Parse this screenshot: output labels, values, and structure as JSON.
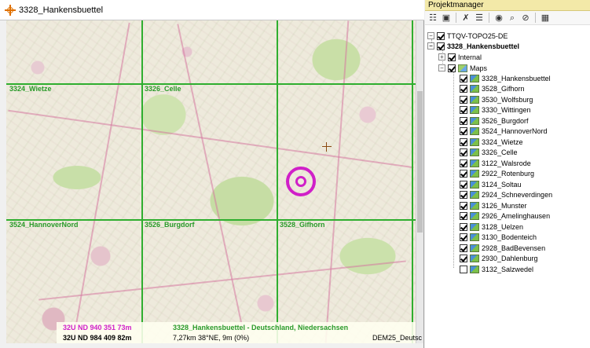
{
  "map_window": {
    "title": "3328_Hankensbuettel",
    "sheet_labels": [
      {
        "text": "3324_Wietze"
      },
      {
        "text": "3326_Celle"
      },
      {
        "text": "3524_HannoverNord"
      },
      {
        "text": "3526_Burgdorf"
      },
      {
        "text": "3528_Gifhorn"
      }
    ],
    "status": {
      "coord_utm_primary": "32U ND 940 351  73m",
      "coord_utm_secondary": "32U ND 984 409  82m",
      "sheet_info": "3328_Hankensbuettel - Deutschland, Niedersachsen",
      "distance_info": "7,27km 38°NE,  9m (0%)",
      "dem_info": "DEM25_Deutsc"
    }
  },
  "project_manager": {
    "title": "Projektmanager",
    "toolbar": [
      {
        "name": "tree-view-icon",
        "glyph": "☷"
      },
      {
        "name": "save-icon",
        "glyph": "▣"
      },
      {
        "name": "delete-icon",
        "glyph": "✗"
      },
      {
        "name": "properties-icon",
        "glyph": "☰"
      },
      {
        "name": "center-icon",
        "glyph": "◉"
      },
      {
        "name": "search-icon",
        "glyph": "⌕"
      },
      {
        "name": "hide-icon",
        "glyph": "⊘"
      },
      {
        "name": "grid-icon",
        "glyph": "▦"
      }
    ],
    "tree": {
      "root": "TTQV-TOPO25-DE",
      "project": "3328_Hankensbuettel",
      "internal": "Internal",
      "maps_folder": "Maps",
      "maps": [
        "3328_Hankensbuettel",
        "3528_Gifhorn",
        "3530_Wolfsburg",
        "3330_Wittingen",
        "3526_Burgdorf",
        "3524_HannoverNord",
        "3324_Wietze",
        "3326_Celle",
        "3122_Walsrode",
        "2922_Rotenburg",
        "3124_Soltau",
        "2924_Schneverdingen",
        "3126_Munster",
        "2926_Amelinghausen",
        "3128_Uelzen",
        "3130_Bodenteich",
        "2928_BadBevensen",
        "2930_Dahlenburg",
        "3132_Salzwedel"
      ]
    }
  }
}
